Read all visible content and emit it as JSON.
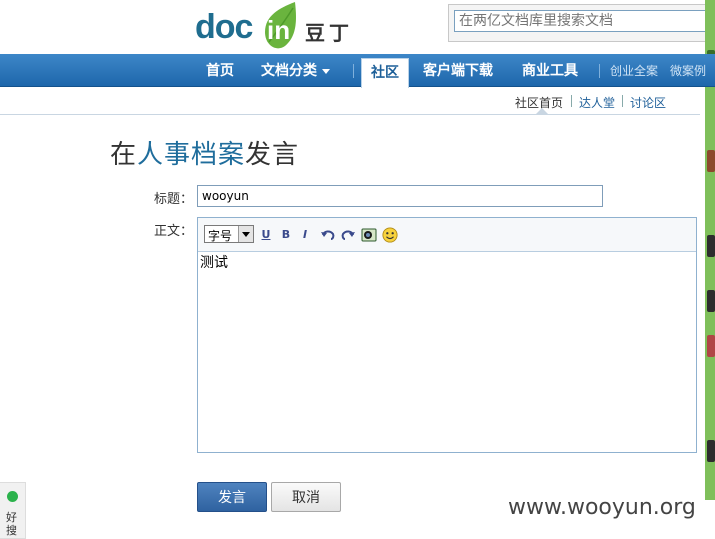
{
  "logo": {
    "brand_latin_1": "doc",
    "brand_latin_2": "in",
    "brand_cn": "豆丁"
  },
  "search": {
    "placeholder": "在两亿文档库里搜索文档"
  },
  "nav": {
    "items": [
      "首页",
      "文档分类",
      "社区",
      "客户端下载",
      "商业工具"
    ],
    "small_items": [
      "创业全案",
      "微案例"
    ]
  },
  "subnav": {
    "items": [
      "社区首页",
      "达人堂",
      "讨论区"
    ]
  },
  "page": {
    "title_prefix": "在",
    "title_group": "人事档案",
    "title_suffix": "发言"
  },
  "form": {
    "title_label": "标题：",
    "title_value": "wooyun",
    "body_label": "正文：",
    "font_size_select": "字号",
    "body_text": "测试"
  },
  "toolbar": {
    "icons": [
      "underline-icon",
      "bold-icon",
      "italic-icon",
      "undo-icon",
      "redo-icon",
      "insert-image-icon",
      "emoticon-icon"
    ],
    "underline_label": "U",
    "bold_label": "B",
    "italic_label": "I"
  },
  "buttons": {
    "submit": "发言",
    "cancel": "取消"
  },
  "haosou": {
    "label": "好搜"
  },
  "watermark": "www.wooyun.org",
  "colors": {
    "nav_blue": "#2a74b9",
    "title_group": "#1f6d9c",
    "logo_green": "#6ab43e",
    "strip_green": "#7fbf5a"
  }
}
